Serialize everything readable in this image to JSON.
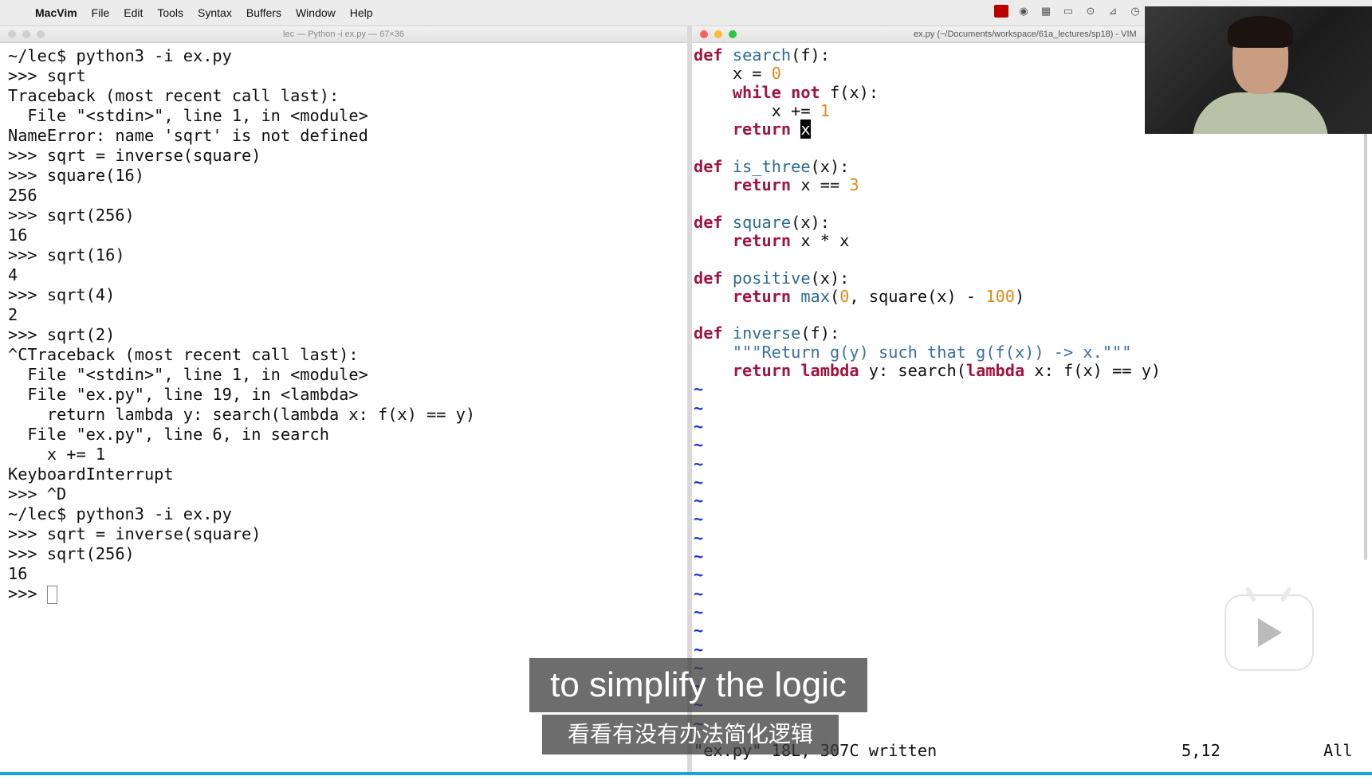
{
  "menubar": {
    "apple": "",
    "app": "MacVim",
    "items": [
      "File",
      "Edit",
      "Tools",
      "Syntax",
      "Buffers",
      "Window",
      "Help"
    ]
  },
  "terminal": {
    "title": "lec — Python -i ex.py — 67×36",
    "lines": [
      "~/lec$ python3 -i ex.py",
      ">>> sqrt",
      "Traceback (most recent call last):",
      "  File \"<stdin>\", line 1, in <module>",
      "NameError: name 'sqrt' is not defined",
      ">>> sqrt = inverse(square)",
      ">>> square(16)",
      "256",
      ">>> sqrt(256)",
      "16",
      ">>> sqrt(16)",
      "4",
      ">>> sqrt(4)",
      "2",
      ">>> sqrt(2)",
      "^CTraceback (most recent call last):",
      "  File \"<stdin>\", line 1, in <module>",
      "  File \"ex.py\", line 19, in <lambda>",
      "    return lambda y: search(lambda x: f(x) == y)",
      "  File \"ex.py\", line 6, in search",
      "    x += 1",
      "KeyboardInterrupt",
      ">>> ^D",
      "~/lec$ python3 -i ex.py",
      ">>> sqrt = inverse(square)",
      ">>> sqrt(256)",
      "16"
    ],
    "prompt": ">>> "
  },
  "vim": {
    "title": "ex.py (~/Documents/workspace/61a_lectures/sp18) - VIM",
    "status_message": "\"ex.py\" 18L, 307C written",
    "cursor_position": "5,12",
    "scroll_percent": "All",
    "tilde": "~"
  },
  "subtitles": {
    "english": "to simplify the logic",
    "chinese": "看看有没有办法简化逻辑"
  }
}
